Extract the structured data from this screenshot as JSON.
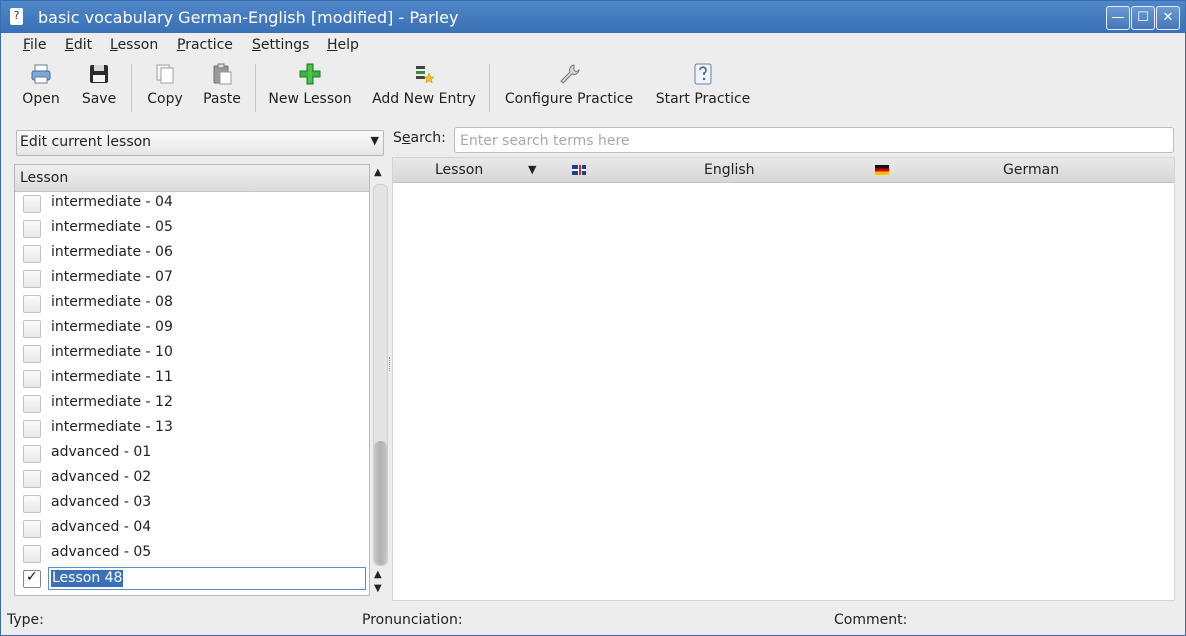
{
  "window": {
    "title": "basic vocabulary German-English [modified] - Parley",
    "app_icon": "?",
    "buttons": {
      "minimize": "—",
      "maximize": "☐",
      "close": "✕"
    }
  },
  "menubar": [
    {
      "label": "File",
      "accel": "F",
      "rest": "ile"
    },
    {
      "label": "Edit",
      "accel": "E",
      "rest": "dit"
    },
    {
      "label": "Lesson",
      "accel": "L",
      "rest": "esson"
    },
    {
      "label": "Practice",
      "accel": "P",
      "rest": "ractice"
    },
    {
      "label": "Settings",
      "accel": "S",
      "rest": "ettings"
    },
    {
      "label": "Help",
      "accel": "H",
      "rest": "elp"
    }
  ],
  "toolbar": {
    "open": "Open",
    "save": "Save",
    "copy": "Copy",
    "paste": "Paste",
    "new_lesson": "New Lesson",
    "add_new_entry": "Add New Entry",
    "configure_practice": "Configure Practice",
    "start_practice": "Start Practice"
  },
  "lesson_panel": {
    "mode_combo": "Edit current lesson",
    "header": "Lesson",
    "items": [
      {
        "label": "intermediate - 04",
        "checked": false
      },
      {
        "label": "intermediate - 05",
        "checked": false
      },
      {
        "label": "intermediate - 06",
        "checked": false
      },
      {
        "label": "intermediate - 07",
        "checked": false
      },
      {
        "label": "intermediate - 08",
        "checked": false
      },
      {
        "label": "intermediate - 09",
        "checked": false
      },
      {
        "label": "intermediate - 10",
        "checked": false
      },
      {
        "label": "intermediate - 11",
        "checked": false
      },
      {
        "label": "intermediate - 12",
        "checked": false
      },
      {
        "label": "intermediate - 13",
        "checked": false
      },
      {
        "label": "advanced - 01",
        "checked": false
      },
      {
        "label": "advanced - 02",
        "checked": false
      },
      {
        "label": "advanced - 03",
        "checked": false
      },
      {
        "label": "advanced - 04",
        "checked": false
      },
      {
        "label": "advanced - 05",
        "checked": false
      }
    ],
    "editing_item": {
      "label": "Lesson 48",
      "checked": true
    }
  },
  "search": {
    "label_prefix": "S",
    "label_accel": "e",
    "label_suffix": "arch:",
    "placeholder": "Enter search terms here",
    "value": ""
  },
  "entries_table": {
    "columns": {
      "lesson": "Lesson",
      "english": "English",
      "german": "German"
    },
    "sort_indicator": "▼",
    "rows": []
  },
  "statusbar": {
    "type": "Type:",
    "pronunciation": "Pronunciation:",
    "comment": "Comment:"
  },
  "colors": {
    "titlebar": "#3a70b5",
    "selection": "#3a70b5",
    "window_bg": "#ededed"
  }
}
